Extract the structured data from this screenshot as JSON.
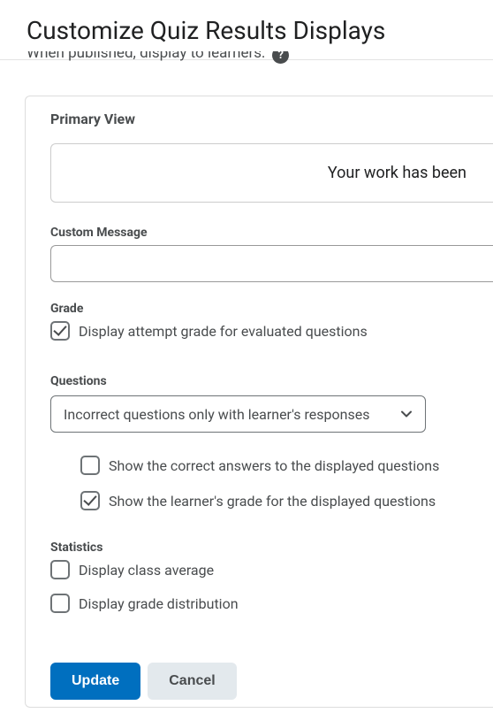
{
  "header": {
    "title": "Customize Quiz Results Displays"
  },
  "subheader": {
    "text": "When published, display to learners:",
    "help": "?"
  },
  "panel": {
    "title": "Primary View",
    "preview_text": "Your work has been",
    "custom_message": {
      "label": "Custom Message",
      "value": ""
    },
    "grade": {
      "label": "Grade",
      "checkbox_label": "Display attempt grade for evaluated questions",
      "checked": true
    },
    "questions": {
      "label": "Questions",
      "selected": "Incorrect questions only with learner's responses",
      "show_correct": {
        "label": "Show the correct answers to the displayed questions",
        "checked": false
      },
      "show_grade": {
        "label": "Show the learner's grade for the displayed questions",
        "checked": true
      }
    },
    "statistics": {
      "label": "Statistics",
      "class_average": {
        "label": "Display class average",
        "checked": false
      },
      "grade_distribution": {
        "label": "Display grade distribution",
        "checked": false
      }
    },
    "buttons": {
      "update": "Update",
      "cancel": "Cancel"
    }
  }
}
